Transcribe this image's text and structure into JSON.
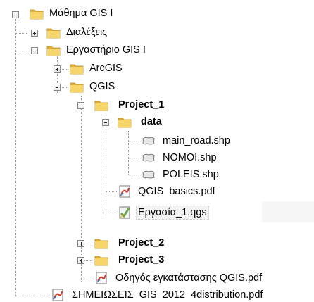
{
  "tree": {
    "root": {
      "label": "Μάθημα GIS I"
    },
    "dialekseis": {
      "label": "Διαλέξεις"
    },
    "ergastirio": {
      "label": "Εργαστήριο GIS I"
    },
    "arcgis": {
      "label": "ArcGIS"
    },
    "qgis": {
      "label": "QGIS"
    },
    "project1": {
      "label": "Project_1"
    },
    "data": {
      "label": "data"
    },
    "main_road": {
      "label": "main_road.shp"
    },
    "nomoi": {
      "label": "NOMOI.shp"
    },
    "poleis": {
      "label": "POLEIS.shp"
    },
    "qgis_basics": {
      "label": "QGIS_basics.pdf"
    },
    "ergasia1": {
      "label": "Εργασία_1.qgs"
    },
    "project2": {
      "label": "Project_2"
    },
    "project3": {
      "label": "Project_3"
    },
    "odigos": {
      "label": "Οδηγός εγκατάστασης QGIS.pdf"
    },
    "simeioseis": {
      "label": "ΣΗΜΕΙΩΣΕΙΣ  GIS  2012  4distribution.pdf"
    }
  },
  "icons": {
    "folder": "folder-icon",
    "shapefile": "shapefile-icon",
    "pdf": "pdf-icon",
    "qgs": "qgs-project-icon"
  },
  "colors": {
    "folder_light": "#f6d56a",
    "folder_dark": "#e0b13a",
    "pdf_red": "#d23a2a",
    "qgs_green": "#6aa84f"
  }
}
